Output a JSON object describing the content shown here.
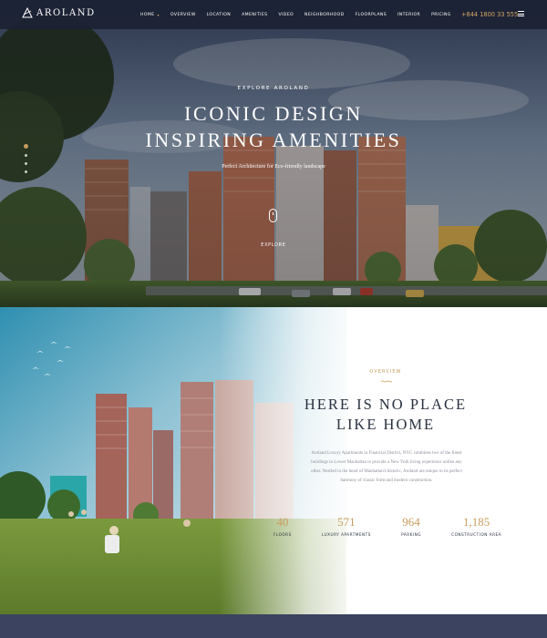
{
  "header": {
    "logo_text": "AROLAND",
    "nav": [
      {
        "label": "HOME"
      },
      {
        "label": "OVERVIEW"
      },
      {
        "label": "LOCATION"
      },
      {
        "label": "AMENITIES"
      },
      {
        "label": "VIDEO"
      },
      {
        "label": "NEIGHBORHOOD"
      },
      {
        "label": "FLOORPLANS"
      },
      {
        "label": "INTERIOR"
      },
      {
        "label": "PRICING"
      }
    ],
    "home_caret": "▾",
    "phone": "+844 1800 33 555"
  },
  "hero": {
    "eyebrow": "EXPLORE AROLAND",
    "title_line1": "ICONIC DESIGN",
    "title_line2": "INSPIRING AMENITIES",
    "subtitle": "Perfect Architecture for Eco-friendly landscape",
    "explore": "EXPLORE",
    "slide_count": 4,
    "active_slide": 1
  },
  "overview": {
    "eyebrow": "OVERVIEW",
    "title_line1": "HERE IS NO PLACE",
    "title_line2": "LIKE HOME",
    "body_line1": "Aroland Luxury Apartments in Financial District, NYC combines two of the finest",
    "body_line2": "buildings in Lower Manhattan to provide a New York living experience unlike any",
    "body_line3": "other. Nestled in the heart of Manhattan's historic, Aroland are unique in its perfect",
    "body_line4": "harmony of classic form and modern construction.",
    "stats": [
      {
        "value": "40",
        "label": "FLOORS"
      },
      {
        "value": "571",
        "label": "LUXURY APARTMENTS"
      },
      {
        "value": "964",
        "label": "PARKING"
      },
      {
        "value": "1,185",
        "label": "CONSTRUCTION AREA"
      }
    ]
  },
  "colors": {
    "accent_gold": "#c89c5e",
    "header_bg": "#1c2234",
    "heading_dark": "#2a3140",
    "footer_band": "#3b4360"
  }
}
